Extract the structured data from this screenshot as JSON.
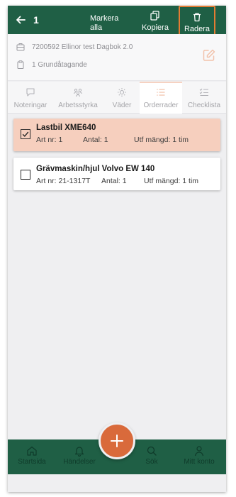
{
  "header": {
    "count": "1",
    "actions": {
      "select_all": "Markera alla",
      "copy": "Kopiera",
      "delete": "Radera"
    }
  },
  "project": {
    "name": "7200592 Ellinor test Dagbok 2.0",
    "contract": "1 Grundåtagande"
  },
  "tabs": [
    {
      "label": "Noteringar",
      "icon": "note-icon"
    },
    {
      "label": "Arbetsstyrka",
      "icon": "people-icon"
    },
    {
      "label": "Väder",
      "icon": "weather-icon"
    },
    {
      "label": "Orderrader",
      "icon": "list-icon",
      "active": true
    },
    {
      "label": "Checklista",
      "icon": "checklist-icon"
    }
  ],
  "orders": [
    {
      "title": "Lastbil XME640",
      "art": "Art nr: 1",
      "qty": "Antal: 1",
      "done": "Utf mängd: 1 tim",
      "selected": true
    },
    {
      "title": "Grävmaskin/hjul Volvo EW 140",
      "art": "Art nr: 21-1317T",
      "qty": "Antal: 1",
      "done": "Utf mängd: 1 tim",
      "selected": false
    }
  ],
  "nav": [
    {
      "label": "Startsida",
      "icon": "home-icon"
    },
    {
      "label": "Händelser",
      "icon": "bell-icon"
    },
    {
      "label": "Sök",
      "icon": "search-icon"
    },
    {
      "label": "Mitt konto",
      "icon": "user-icon"
    }
  ],
  "colors": {
    "brand_green": "#1f5f45",
    "accent_orange": "#d96a3b",
    "selected_row": "#f6cfbe",
    "highlight_border": "#e37c33"
  }
}
